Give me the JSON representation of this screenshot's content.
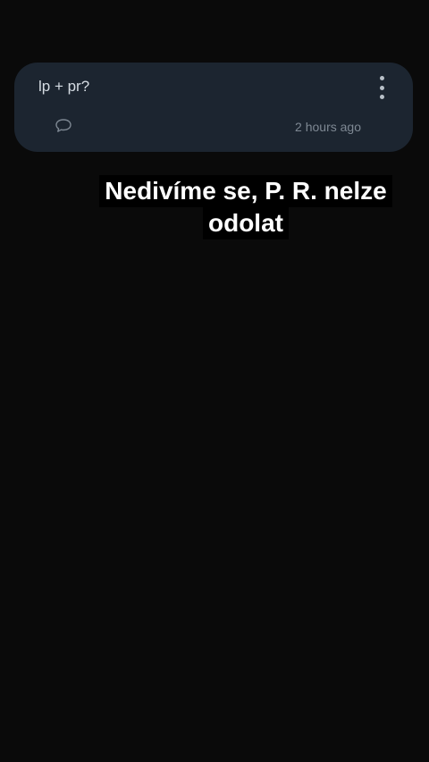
{
  "post": {
    "text": "lp + pr?",
    "timestamp": "2 hours ago",
    "comment_icon": "speech-bubble-icon",
    "menu_icon": "more-vertical-icon"
  },
  "caption": {
    "line1": "Nedivíme se, P. R. nelze",
    "line2": "odolat"
  },
  "colors": {
    "background": "#0a0a0a",
    "card": "#1c2530",
    "caption_text": "#ffffff"
  }
}
